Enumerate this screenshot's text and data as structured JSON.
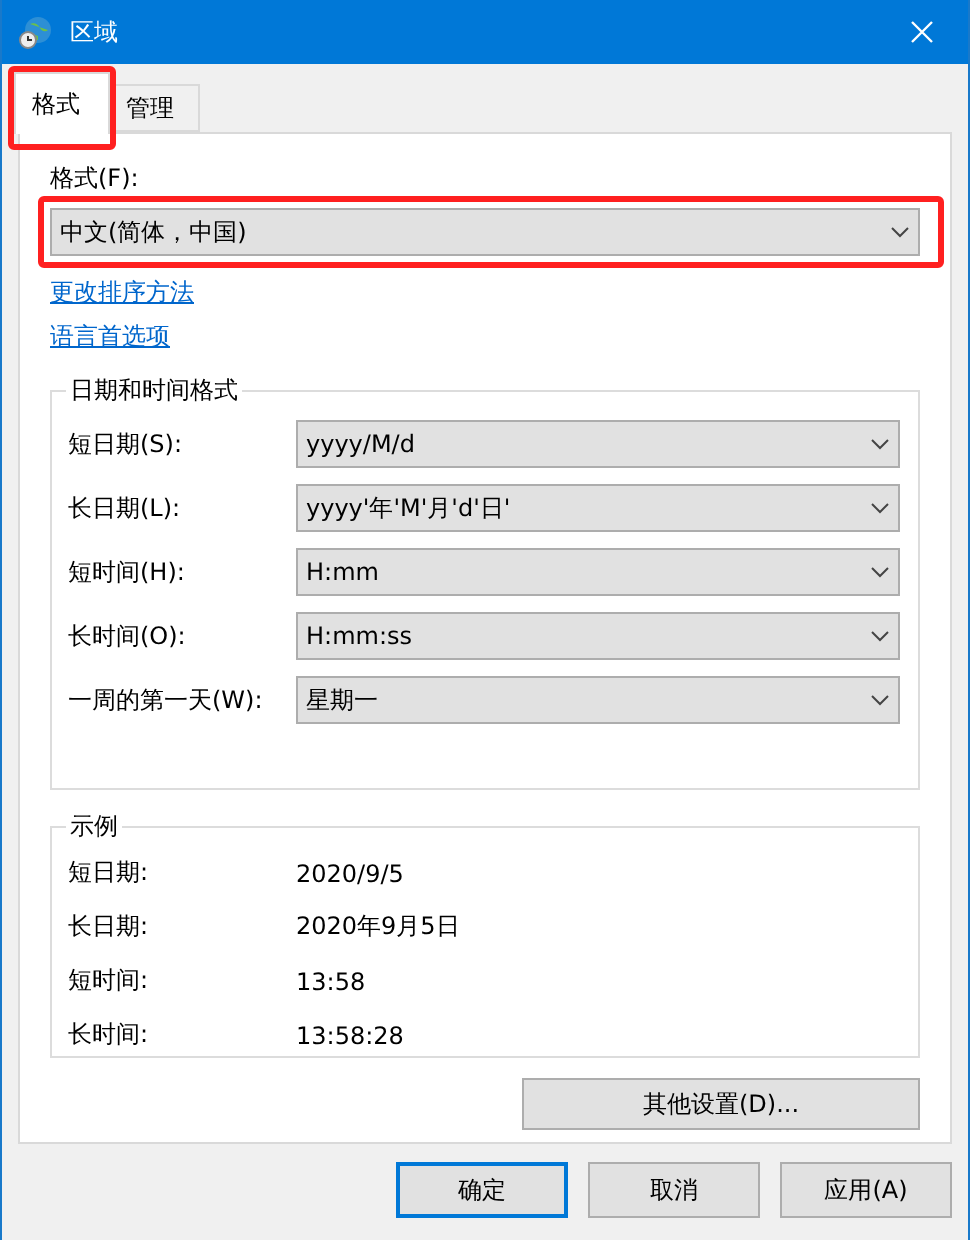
{
  "window": {
    "title": "区域"
  },
  "tabs": [
    {
      "label": "格式",
      "selected": true,
      "highlighted": true
    },
    {
      "label": "管理",
      "selected": false,
      "highlighted": false
    }
  ],
  "format": {
    "label": "格式(F):",
    "value": "中文(简体，中国)",
    "highlighted": true
  },
  "links": [
    "更改排序方法",
    "语言首选项"
  ],
  "date_time_formats": {
    "title": "日期和时间格式",
    "rows": [
      {
        "label": "短日期(S):",
        "value": "yyyy/M/d"
      },
      {
        "label": "长日期(L):",
        "value": "yyyy'年'M'月'd'日'"
      },
      {
        "label": "短时间(H):",
        "value": "H:mm"
      },
      {
        "label": "长时间(O):",
        "value": "H:mm:ss"
      },
      {
        "label": "一周的第一天(W):",
        "value": "星期一"
      }
    ]
  },
  "examples": {
    "title": "示例",
    "rows": [
      {
        "label": "短日期:",
        "value": "2020/9/5"
      },
      {
        "label": "长日期:",
        "value": "2020年9月5日"
      },
      {
        "label": "短时间:",
        "value": "13:58"
      },
      {
        "label": "长时间:",
        "value": "13:58:28"
      }
    ]
  },
  "additional_settings_button": "其他设置(D)...",
  "buttons": [
    {
      "label": "确定",
      "default": true
    },
    {
      "label": "取消",
      "default": false
    },
    {
      "label": "应用(A)",
      "default": false
    }
  ]
}
